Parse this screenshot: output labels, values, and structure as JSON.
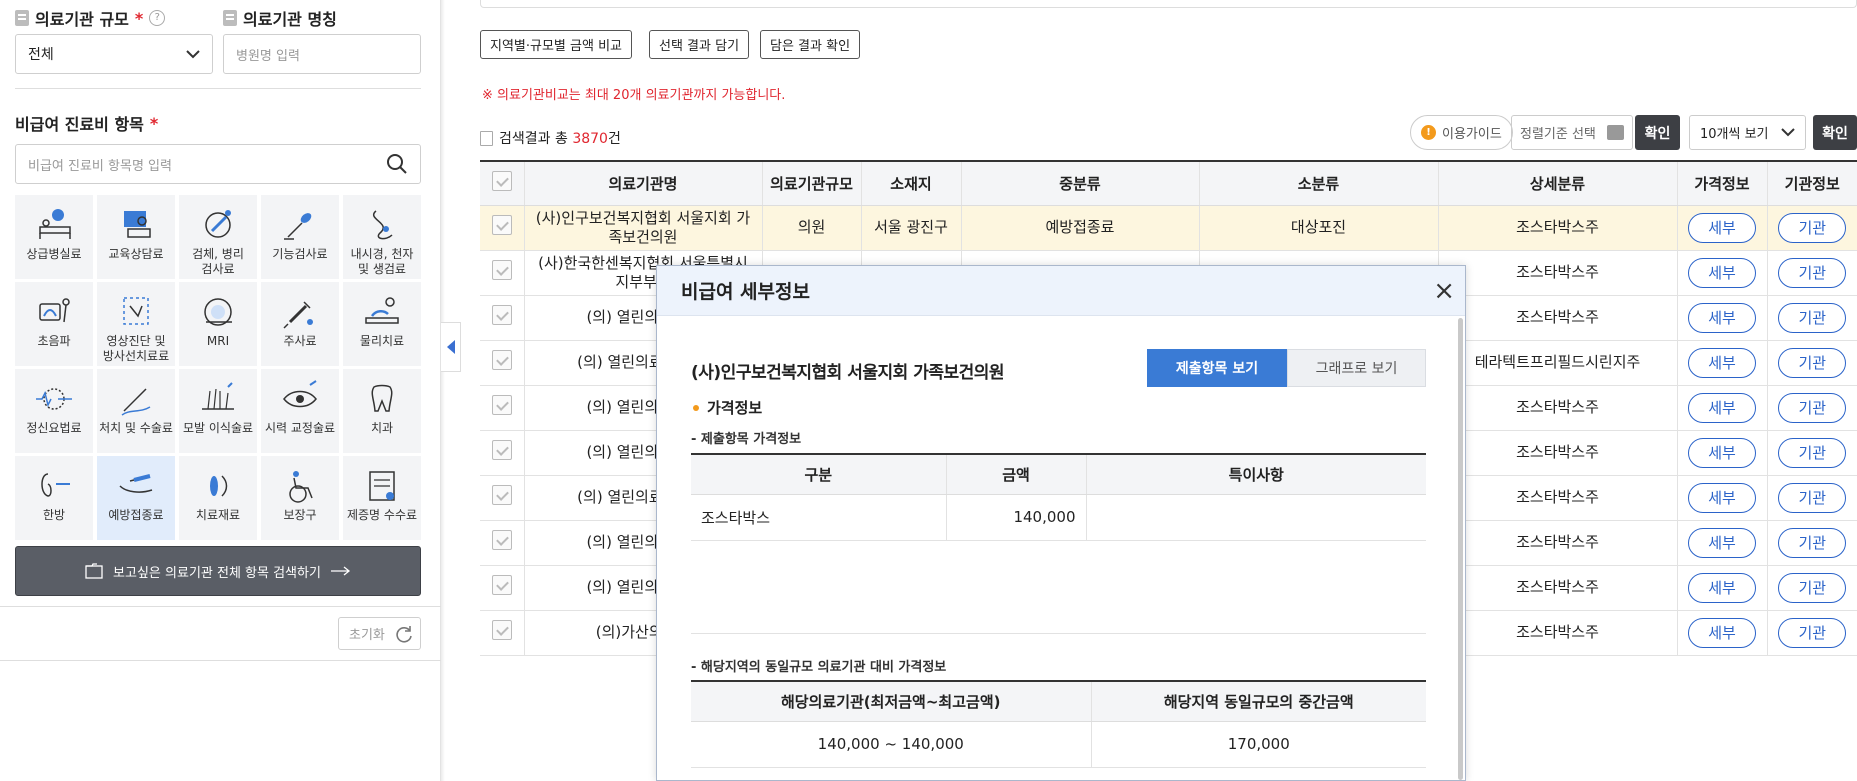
{
  "sidebar": {
    "size_label": "의료기관 규모",
    "required_mark": "*",
    "help_icon": "?",
    "size_value": "전체",
    "name_label": "의료기관 명칭",
    "name_placeholder": "병원명 입력",
    "items_label": "비급여 진료비 항목",
    "items_placeholder": "비급여 진료비 항목명 입력",
    "categories": [
      {
        "label": "상급병실료",
        "icon": "hospital-bed-icon"
      },
      {
        "label": "교육상담료",
        "icon": "counseling-icon"
      },
      {
        "label": "검체, 병리\n검사료",
        "icon": "microscope-icon"
      },
      {
        "label": "기능검사료",
        "icon": "function-test-icon"
      },
      {
        "label": "내시경, 천자\n및 생검료",
        "icon": "endoscope-icon"
      },
      {
        "label": "초음파",
        "icon": "ultrasound-icon"
      },
      {
        "label": "영상진단 및\n방사선치료료",
        "icon": "xray-icon"
      },
      {
        "label": "MRI",
        "icon": "mri-icon"
      },
      {
        "label": "주사료",
        "icon": "syringe-icon"
      },
      {
        "label": "물리치료",
        "icon": "physiotherapy-icon"
      },
      {
        "label": "정신요법료",
        "icon": "brain-icon"
      },
      {
        "label": "처치 및 수술료",
        "icon": "surgery-icon"
      },
      {
        "label": "모발 이식술료",
        "icon": "hair-transplant-icon"
      },
      {
        "label": "시력 교정술료",
        "icon": "eye-icon"
      },
      {
        "label": "치과",
        "icon": "tooth-icon"
      },
      {
        "label": "한방",
        "icon": "acupuncture-icon"
      },
      {
        "label": "예방접종료",
        "icon": "vaccine-icon",
        "selected": true
      },
      {
        "label": "치료재료",
        "icon": "material-icon"
      },
      {
        "label": "보장구",
        "icon": "wheelchair-icon"
      },
      {
        "label": "제증명 수수료",
        "icon": "certificate-icon"
      }
    ],
    "search_all_label": "보고싶은 의료기관 전체 항목 검색하기",
    "reset_label": "초기화"
  },
  "toolbar": {
    "compare_label": "지역별·규모별 금액 비교",
    "add_label": "선택 결과 담기",
    "view_label": "담은 결과 확인",
    "notice": "※ 의료기관비교는 최대 20개 의료기관까지 가능합니다.",
    "result_prefix": "검색결과 총 ",
    "result_count": "3870",
    "result_suffix": "건",
    "guide_label": "이용가이드",
    "sort_label": "정렬기준 선택",
    "confirm_label": "확인",
    "page_size_label": "10개씩 보기",
    "confirm2_label": "확인"
  },
  "table": {
    "headers": [
      "의료기관명",
      "의료기관규모",
      "소재지",
      "중분류",
      "소분류",
      "상세분류",
      "가격정보",
      "기관정보"
    ],
    "detail_label": "세부",
    "agency_label": "기관",
    "rows": [
      {
        "name": "(사)인구보건복지협회 서울지회 가족보건의원",
        "size": "의원",
        "loc": "서울 광진구",
        "mid": "예방접종료",
        "small": "대상포진",
        "detail": "조스타박스주"
      },
      {
        "name": "(사)한국한센복지협회 서울특별시 지부부설",
        "size": "",
        "loc": "",
        "mid": "",
        "small": "",
        "detail": "조스타박스주"
      },
      {
        "name": "(의) 열린의료재단",
        "size": "",
        "loc": "",
        "mid": "",
        "small": "",
        "detail": "조스타박스주"
      },
      {
        "name": "(의) 열린의료재단 봉",
        "size": "",
        "loc": "",
        "mid": "",
        "small": "",
        "detail": "테라텍트프리필드시린지주"
      },
      {
        "name": "(의) 열린의료재단",
        "size": "",
        "loc": "",
        "mid": "",
        "small": "",
        "detail": "조스타박스주"
      },
      {
        "name": "(의) 열린의료재단",
        "size": "",
        "loc": "",
        "mid": "",
        "small": "",
        "detail": "조스타박스주"
      },
      {
        "name": "(의) 열린의료재단 앙",
        "size": "",
        "loc": "",
        "mid": "",
        "small": "",
        "detail": "조스타박스주"
      },
      {
        "name": "(의) 열린의료재단",
        "size": "",
        "loc": "",
        "mid": "",
        "small": "",
        "detail": "조스타박스주"
      },
      {
        "name": "(의) 열린의료재단",
        "size": "",
        "loc": "",
        "mid": "",
        "small": "",
        "detail": "조스타박스주"
      },
      {
        "name": "(의)가산의료재",
        "size": "",
        "loc": "",
        "mid": "",
        "small": "",
        "detail": "조스타박스주"
      }
    ]
  },
  "modal": {
    "title": "비급여 세부정보",
    "close": "×",
    "hospital": "(사)인구보건복지협회 서울지회 가족보건의원",
    "tab_submit": "제출항목 보기",
    "tab_graph": "그래프로 보기",
    "section": "가격정보",
    "sub1": "- 제출항목 가격정보",
    "t1_headers": [
      "구분",
      "금액",
      "특이사항"
    ],
    "t1_row": [
      "조스타박스",
      "140,000",
      ""
    ],
    "sub2": "- 해당지역의 동일규모 의료기관 대비 가격정보",
    "t2_headers": [
      "해당의료기관(최저금액~최고금액)",
      "해당지역 동일규모의 중간금액"
    ],
    "t2_row": [
      "140,000 ~ 140,000",
      "170,000"
    ]
  }
}
